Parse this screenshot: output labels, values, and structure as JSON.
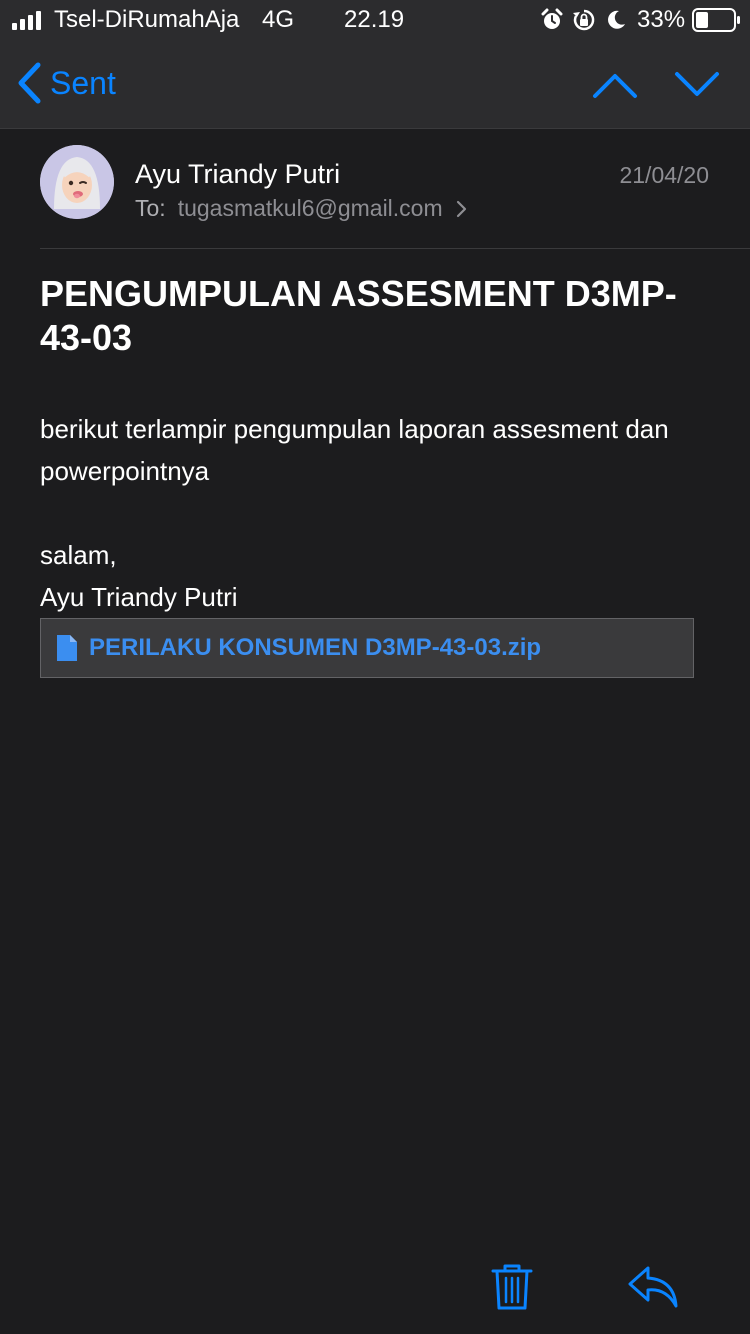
{
  "status_bar": {
    "carrier": "Tsel-DiRumahAja",
    "network": "4G",
    "time": "22.19",
    "battery_percent": "33%",
    "battery_level": 0.33,
    "signal_bars_filled": 4
  },
  "nav": {
    "back_label": "Sent"
  },
  "message": {
    "sender_name": "Ayu Triandy Putri",
    "to_label": "To:",
    "to_email": "tugasmatkul6@gmail.com",
    "date": "21/04/20",
    "subject": "PENGUMPULAN ASSESMENT D3MP-43-03",
    "body_line_1": "berikut terlampir pengumpulan laporan assesment dan powerpointnya",
    "greeting": "salam,",
    "signature": "Ayu Triandy Putri",
    "attachment_name": "PERILAKU KONSUMEN D3MP-43-03.zip"
  },
  "icons": {
    "back": "chevron-left-icon",
    "prev": "chevron-up-icon",
    "next": "chevron-down-icon",
    "trash": "trash-icon",
    "reply": "reply-icon",
    "attachment": "document-icon"
  },
  "colors": {
    "accent": "#0a84ff",
    "background": "#1c1c1e",
    "bar_background": "#2c2c2e"
  }
}
